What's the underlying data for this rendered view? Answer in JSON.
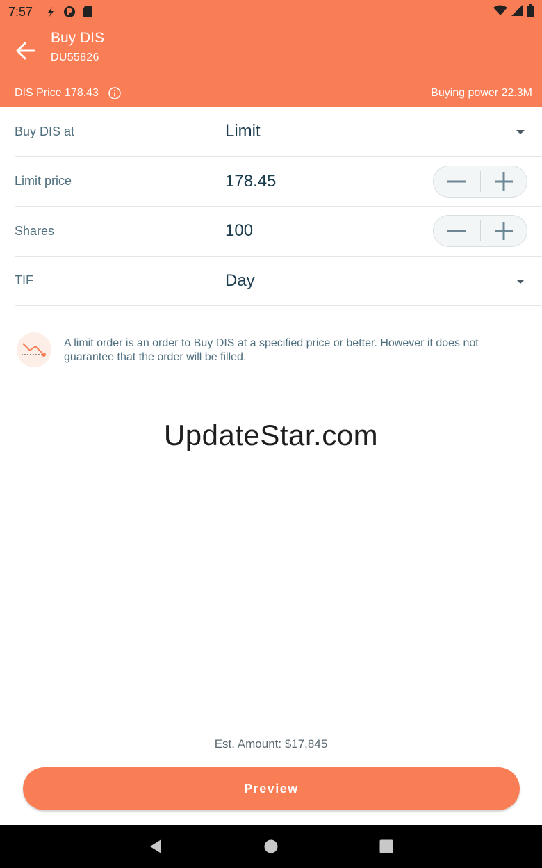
{
  "status_bar": {
    "time": "7:57"
  },
  "header": {
    "title": "Buy DIS",
    "account": "DU55826",
    "price_text": "DIS Price 178.43",
    "buying_power": "Buying power 22.3M"
  },
  "form": {
    "order_type": {
      "label": "Buy DIS at",
      "value": "Limit"
    },
    "limit_price": {
      "label": "Limit price",
      "value": "178.45"
    },
    "shares": {
      "label": "Shares",
      "value": "100"
    },
    "tif": {
      "label": "TIF",
      "value": "Day"
    }
  },
  "note": {
    "text": "A limit order is an order to Buy DIS at a specified price or better. However it does not guarantee that the order will be filled."
  },
  "watermark": "UpdateStar.com",
  "footer": {
    "est_amount": "Est. Amount: $17,845",
    "preview_label": "Preview"
  },
  "colors": {
    "accent": "#f97e56",
    "text_dark": "#1c3d4e",
    "text_muted": "#4f6f7e"
  }
}
